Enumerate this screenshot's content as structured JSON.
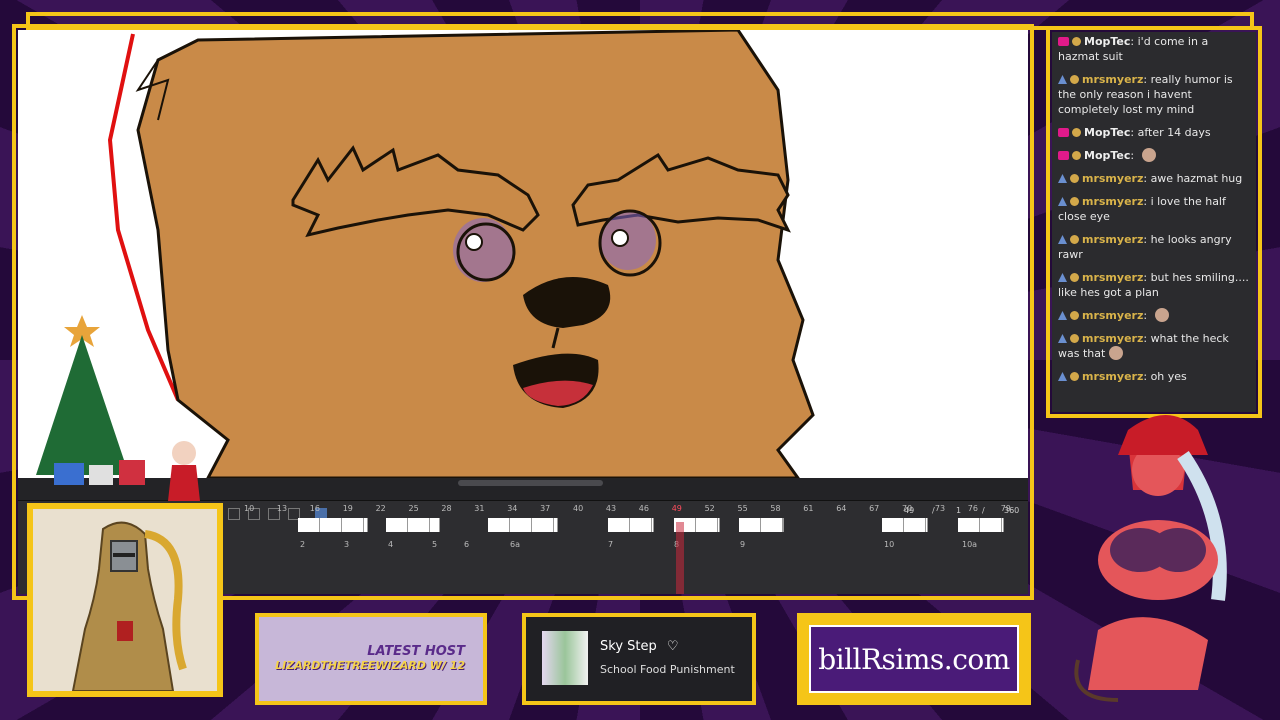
{
  "timeline": {
    "counter": {
      "current": "49",
      "slash1": "/",
      "step": "1",
      "slash2": "/",
      "total": "360"
    },
    "frame_numbers": [
      "10",
      "13",
      "16",
      "19",
      "22",
      "25",
      "28",
      "31",
      "34",
      "37",
      "40",
      "43",
      "46",
      "49",
      "52",
      "55",
      "58",
      "61",
      "64",
      "67",
      "70",
      "73",
      "76",
      "79"
    ],
    "playhead_frame": "49",
    "cel_labels": [
      "2",
      "3",
      "4",
      "5",
      "6",
      "6a",
      "7",
      "8",
      "9",
      "10",
      "10a"
    ]
  },
  "chat": {
    "messages": [
      {
        "user": "MopTec",
        "badge": "heart",
        "color": "white",
        "text": "i'd come in a hazmat suit"
      },
      {
        "user": "mrsmyerz",
        "badge": "sub",
        "color": "gold",
        "text": "really humor is the only reason i havent completely lost my mind"
      },
      {
        "user": "MopTec",
        "badge": "heart",
        "color": "white",
        "text": "after 14 days"
      },
      {
        "user": "MopTec",
        "badge": "heart",
        "color": "white",
        "text": "",
        "emote": true
      },
      {
        "user": "mrsmyerz",
        "badge": "sub",
        "color": "gold",
        "text": "awe hazmat hug"
      },
      {
        "user": "mrsmyerz",
        "badge": "sub",
        "color": "gold",
        "text": "i love the half close eye"
      },
      {
        "user": "mrsmyerz",
        "badge": "sub",
        "color": "gold",
        "text": "he looks angry rawr"
      },
      {
        "user": "mrsmyerz",
        "badge": "sub",
        "color": "gold",
        "text": "but hes smiling.... like hes got a plan"
      },
      {
        "user": "mrsmyerz",
        "badge": "sub",
        "color": "gold",
        "text": "",
        "emote": true
      },
      {
        "user": "mrsmyerz",
        "badge": "sub",
        "color": "gold",
        "text": "what the heck was that",
        "emote": true
      },
      {
        "user": "mrsmyerz",
        "badge": "sub",
        "color": "gold",
        "text": "oh yes"
      }
    ]
  },
  "latest_host": {
    "title": "LATEST HOST",
    "name": "LIZARDTHETREEWIZARD W/ 12"
  },
  "now_playing": {
    "song": "Sky Step",
    "artist": "School Food Punishment",
    "icon": "heart-outline-icon"
  },
  "website": {
    "label": "billRsims.com"
  },
  "colors": {
    "frame": "#f5c518",
    "background": "#3a1456",
    "accent": "#4a1b78"
  }
}
